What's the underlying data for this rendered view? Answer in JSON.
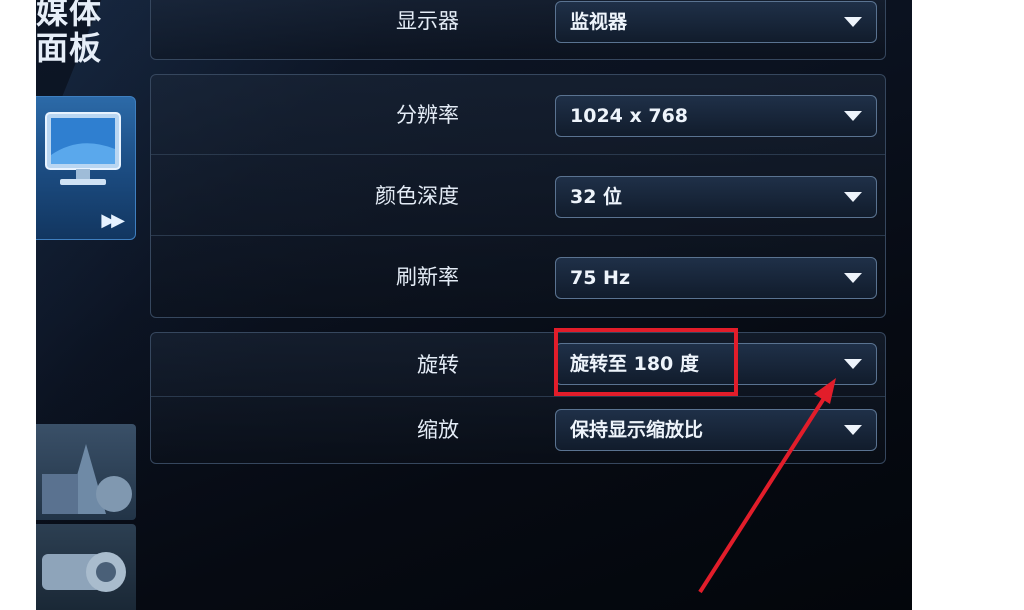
{
  "sidebar": {
    "title_line1": "媒体",
    "title_line2": "面板",
    "icons": {
      "monitor": "monitor-icon",
      "forward": "fast-forward-icon"
    }
  },
  "settings": {
    "display": {
      "label": "显示器",
      "value": "监视器"
    },
    "resolution": {
      "label": "分辨率",
      "value": "1024 x 768"
    },
    "color_depth": {
      "label": "颜色深度",
      "value": "32 位"
    },
    "refresh_rate": {
      "label": "刷新率",
      "value": "75 Hz"
    },
    "rotation": {
      "label": "旋转",
      "value": "旋转至 180 度"
    },
    "scaling": {
      "label": "缩放",
      "value": "保持显示缩放比"
    }
  },
  "annotation": {
    "highlight_color": "#e21d2a",
    "arrow_color": "#e21d2a"
  },
  "colors": {
    "background": "#0b1220",
    "text": "#e4ecf6",
    "accent": "#2c6aa8"
  }
}
